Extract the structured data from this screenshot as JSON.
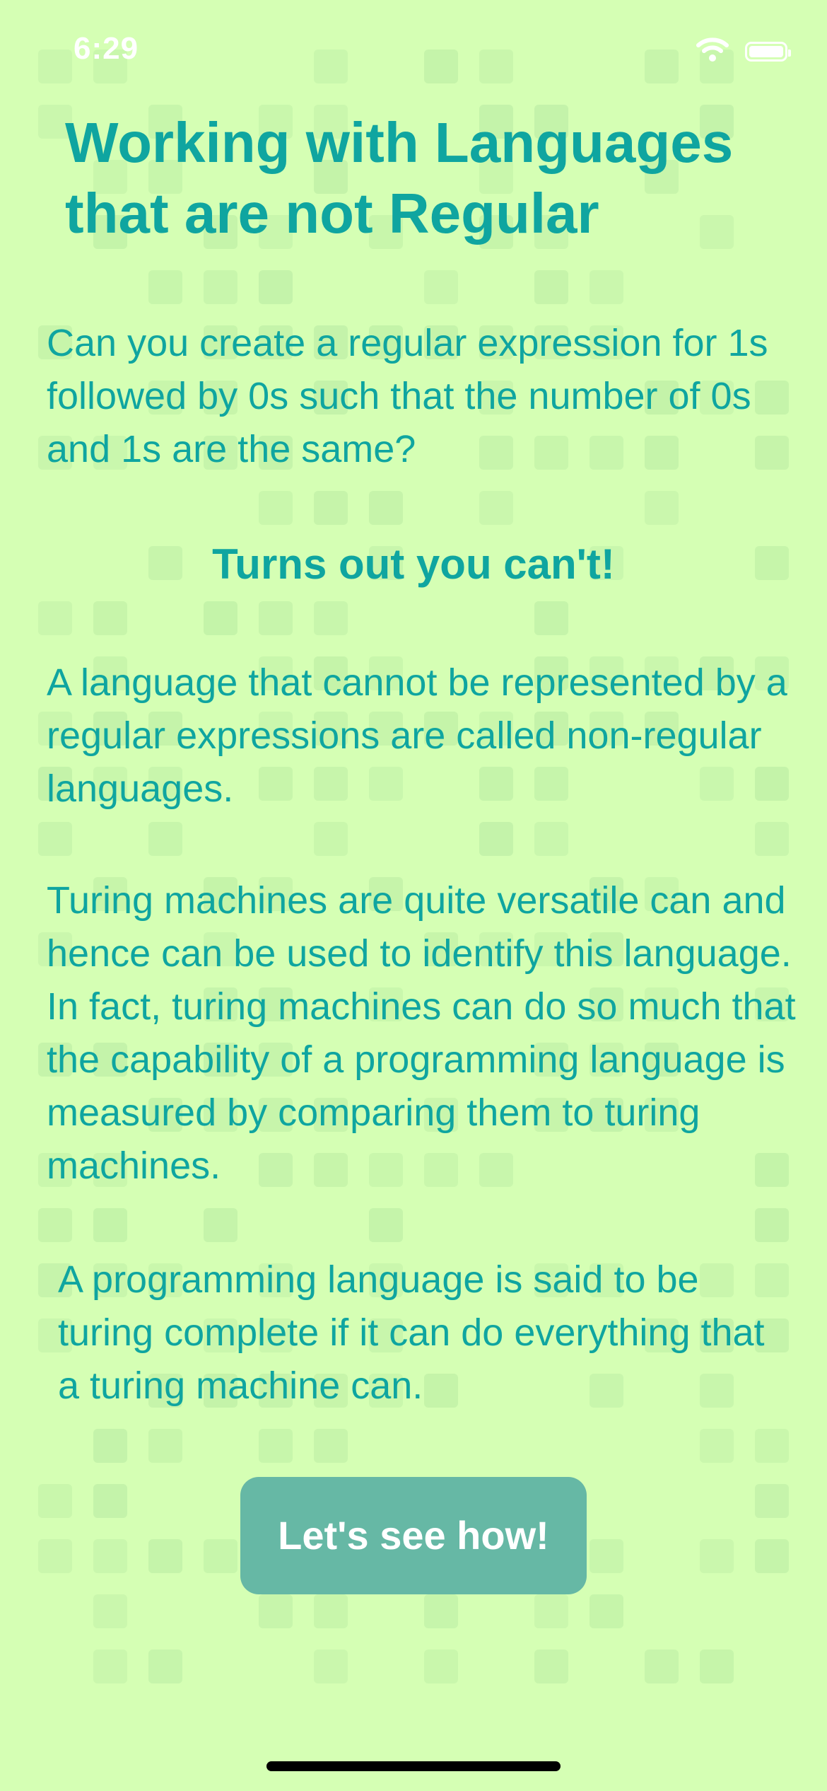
{
  "status_bar": {
    "time": "6:29",
    "icons": [
      "wifi-icon",
      "battery-icon"
    ]
  },
  "title": "Working with Languages that are not Regular",
  "paragraphs": {
    "p1": "Can you create a regular expression for 1s followed by 0s such that the number of 0s and 1s are the same?",
    "subheading": "Turns out you can't!",
    "p3": "A language that cannot be represented by a regular expressions are called non-regular languages.",
    "p4": "Turing machines are quite versatile can and hence can be used to identify this language. In fact, turing machines can do so much that the capability of a programming language is measured by comparing them to turing machines.",
    "p5": "A programming language is said to be turing complete if it can do everything that a turing machine can."
  },
  "cta": {
    "label": "Let's see how!"
  },
  "colors": {
    "background": "#d5ffb4",
    "text_accent": "#0fa5a0",
    "button": "#66b8a5",
    "button_text": "#ffffff",
    "grid_tile": "#bff0a6"
  }
}
